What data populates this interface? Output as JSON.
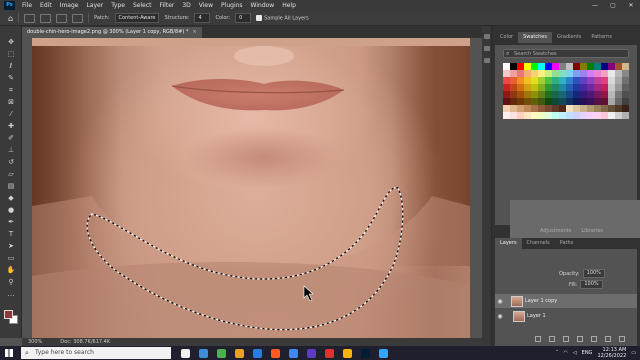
{
  "menubar": {
    "logo": "Ps",
    "items": [
      "File",
      "Edit",
      "Image",
      "Layer",
      "Type",
      "Select",
      "Filter",
      "3D",
      "View",
      "Plugins",
      "Window",
      "Help"
    ],
    "controls": [
      "—",
      "▢",
      "✕"
    ]
  },
  "options": {
    "patch_label": "Patch:",
    "patch_value": "Content-Aware",
    "structure_label": "Structure:",
    "structure_value": "4",
    "color_label": "Color:",
    "color_value": "0",
    "sample_all_layers": "Sample All Layers"
  },
  "document": {
    "tab_title": "double-chin-hero-image2.png @ 300% (Layer 1 copy, RGB/8#) *",
    "close": "×"
  },
  "status": {
    "zoom": "300%",
    "doc_size": "Doc: 308.7K/617.4K"
  },
  "swatches_tabs": [
    "Color",
    "Swatches",
    "Gradients",
    "Patterns"
  ],
  "swatches_search_placeholder": "Search Swatches",
  "libraries_tabs": [
    "Adjustments",
    "Libraries"
  ],
  "layers_tabs": [
    "Layers",
    "Channels",
    "Paths"
  ],
  "layers": {
    "opacity_label": "Opacity:",
    "opacity_value": "100%",
    "fill_label": "Fill:",
    "fill_value": "100%",
    "items": [
      {
        "name": "Layer 1 copy",
        "selected": true
      },
      {
        "name": "Layer 1",
        "selected": false
      }
    ]
  },
  "swatch_colors": [
    "#ffffff",
    "#000000",
    "#ff0000",
    "#ffff00",
    "#00ff00",
    "#00ffff",
    "#0000ff",
    "#ff00ff",
    "#808080",
    "#c0c0c0",
    "#800000",
    "#808000",
    "#008000",
    "#008080",
    "#000080",
    "#800080",
    "#a0522d",
    "#d2b48c",
    "#f8c8c8",
    "#f0a0a0",
    "#e87878",
    "#f4b070",
    "#f8d070",
    "#f8f080",
    "#c8f080",
    "#90e090",
    "#80e0c0",
    "#80d0f0",
    "#80a0f0",
    "#a080f0",
    "#d080f0",
    "#f080d0",
    "#f0a0c0",
    "#e8e8e8",
    "#b8b8b8",
    "#888888",
    "#e84848",
    "#e86030",
    "#f09020",
    "#f0c020",
    "#e0e020",
    "#a0d030",
    "#50c040",
    "#30b080",
    "#30b0c0",
    "#3080d0",
    "#3050c0",
    "#6040c0",
    "#9040c0",
    "#c040a0",
    "#e04080",
    "#d8d8d8",
    "#a8a8a8",
    "#707070",
    "#c82020",
    "#c04818",
    "#d07010",
    "#d0a010",
    "#c0c010",
    "#80b020",
    "#309830",
    "#208868",
    "#2088a0",
    "#2060b0",
    "#2038a0",
    "#4828a0",
    "#7028a0",
    "#a02880",
    "#c02060",
    "#c8c8c8",
    "#989898",
    "#606060",
    "#901818",
    "#903810",
    "#a05008",
    "#a07808",
    "#909008",
    "#608018",
    "#207020",
    "#186850",
    "#186878",
    "#184888",
    "#182878",
    "#381878",
    "#501878",
    "#781860",
    "#901848",
    "#b8b8b8",
    "#787878",
    "#505050",
    "#601010",
    "#602808",
    "#703808",
    "#705008",
    "#606008",
    "#405810",
    "#104810",
    "#104838",
    "#104858",
    "#103060",
    "#101858",
    "#281058",
    "#381058",
    "#581048",
    "#601030",
    "#a8a8a8",
    "#686868",
    "#404040",
    "#f0d0b0",
    "#e0b890",
    "#d0a070",
    "#c08858",
    "#a87048",
    "#905838",
    "#784830",
    "#603828",
    "#502818",
    "#f0e0c0",
    "#e0c8a0",
    "#c8b088",
    "#b09870",
    "#988058",
    "#806848",
    "#685038",
    "#503828",
    "#382018",
    "#fff0f0",
    "#ffe0e0",
    "#ffd0c0",
    "#ffe8c0",
    "#fff8c0",
    "#f0ffc0",
    "#e0ffe0",
    "#c0fff0",
    "#c0f0ff",
    "#c0e0ff",
    "#d0d0ff",
    "#e8d0ff",
    "#f8d0ff",
    "#ffd0f0",
    "#ffc8d8",
    "#f0f0f0",
    "#d0d0d0",
    "#b0b0b0"
  ],
  "taskbar": {
    "search_placeholder": "Type here to search",
    "app_colors": [
      "#f0f0f0",
      "#3c8fd8",
      "#4caf50",
      "#e8a020",
      "#2a7de0",
      "#ff5a1f",
      "#4285f4",
      "#5b3cc4",
      "#e03030",
      "#f6b40e",
      "#001e36",
      "#31a8ff"
    ],
    "lang": "ENG",
    "time": "12:13 AM",
    "date": "12/26/2022"
  }
}
